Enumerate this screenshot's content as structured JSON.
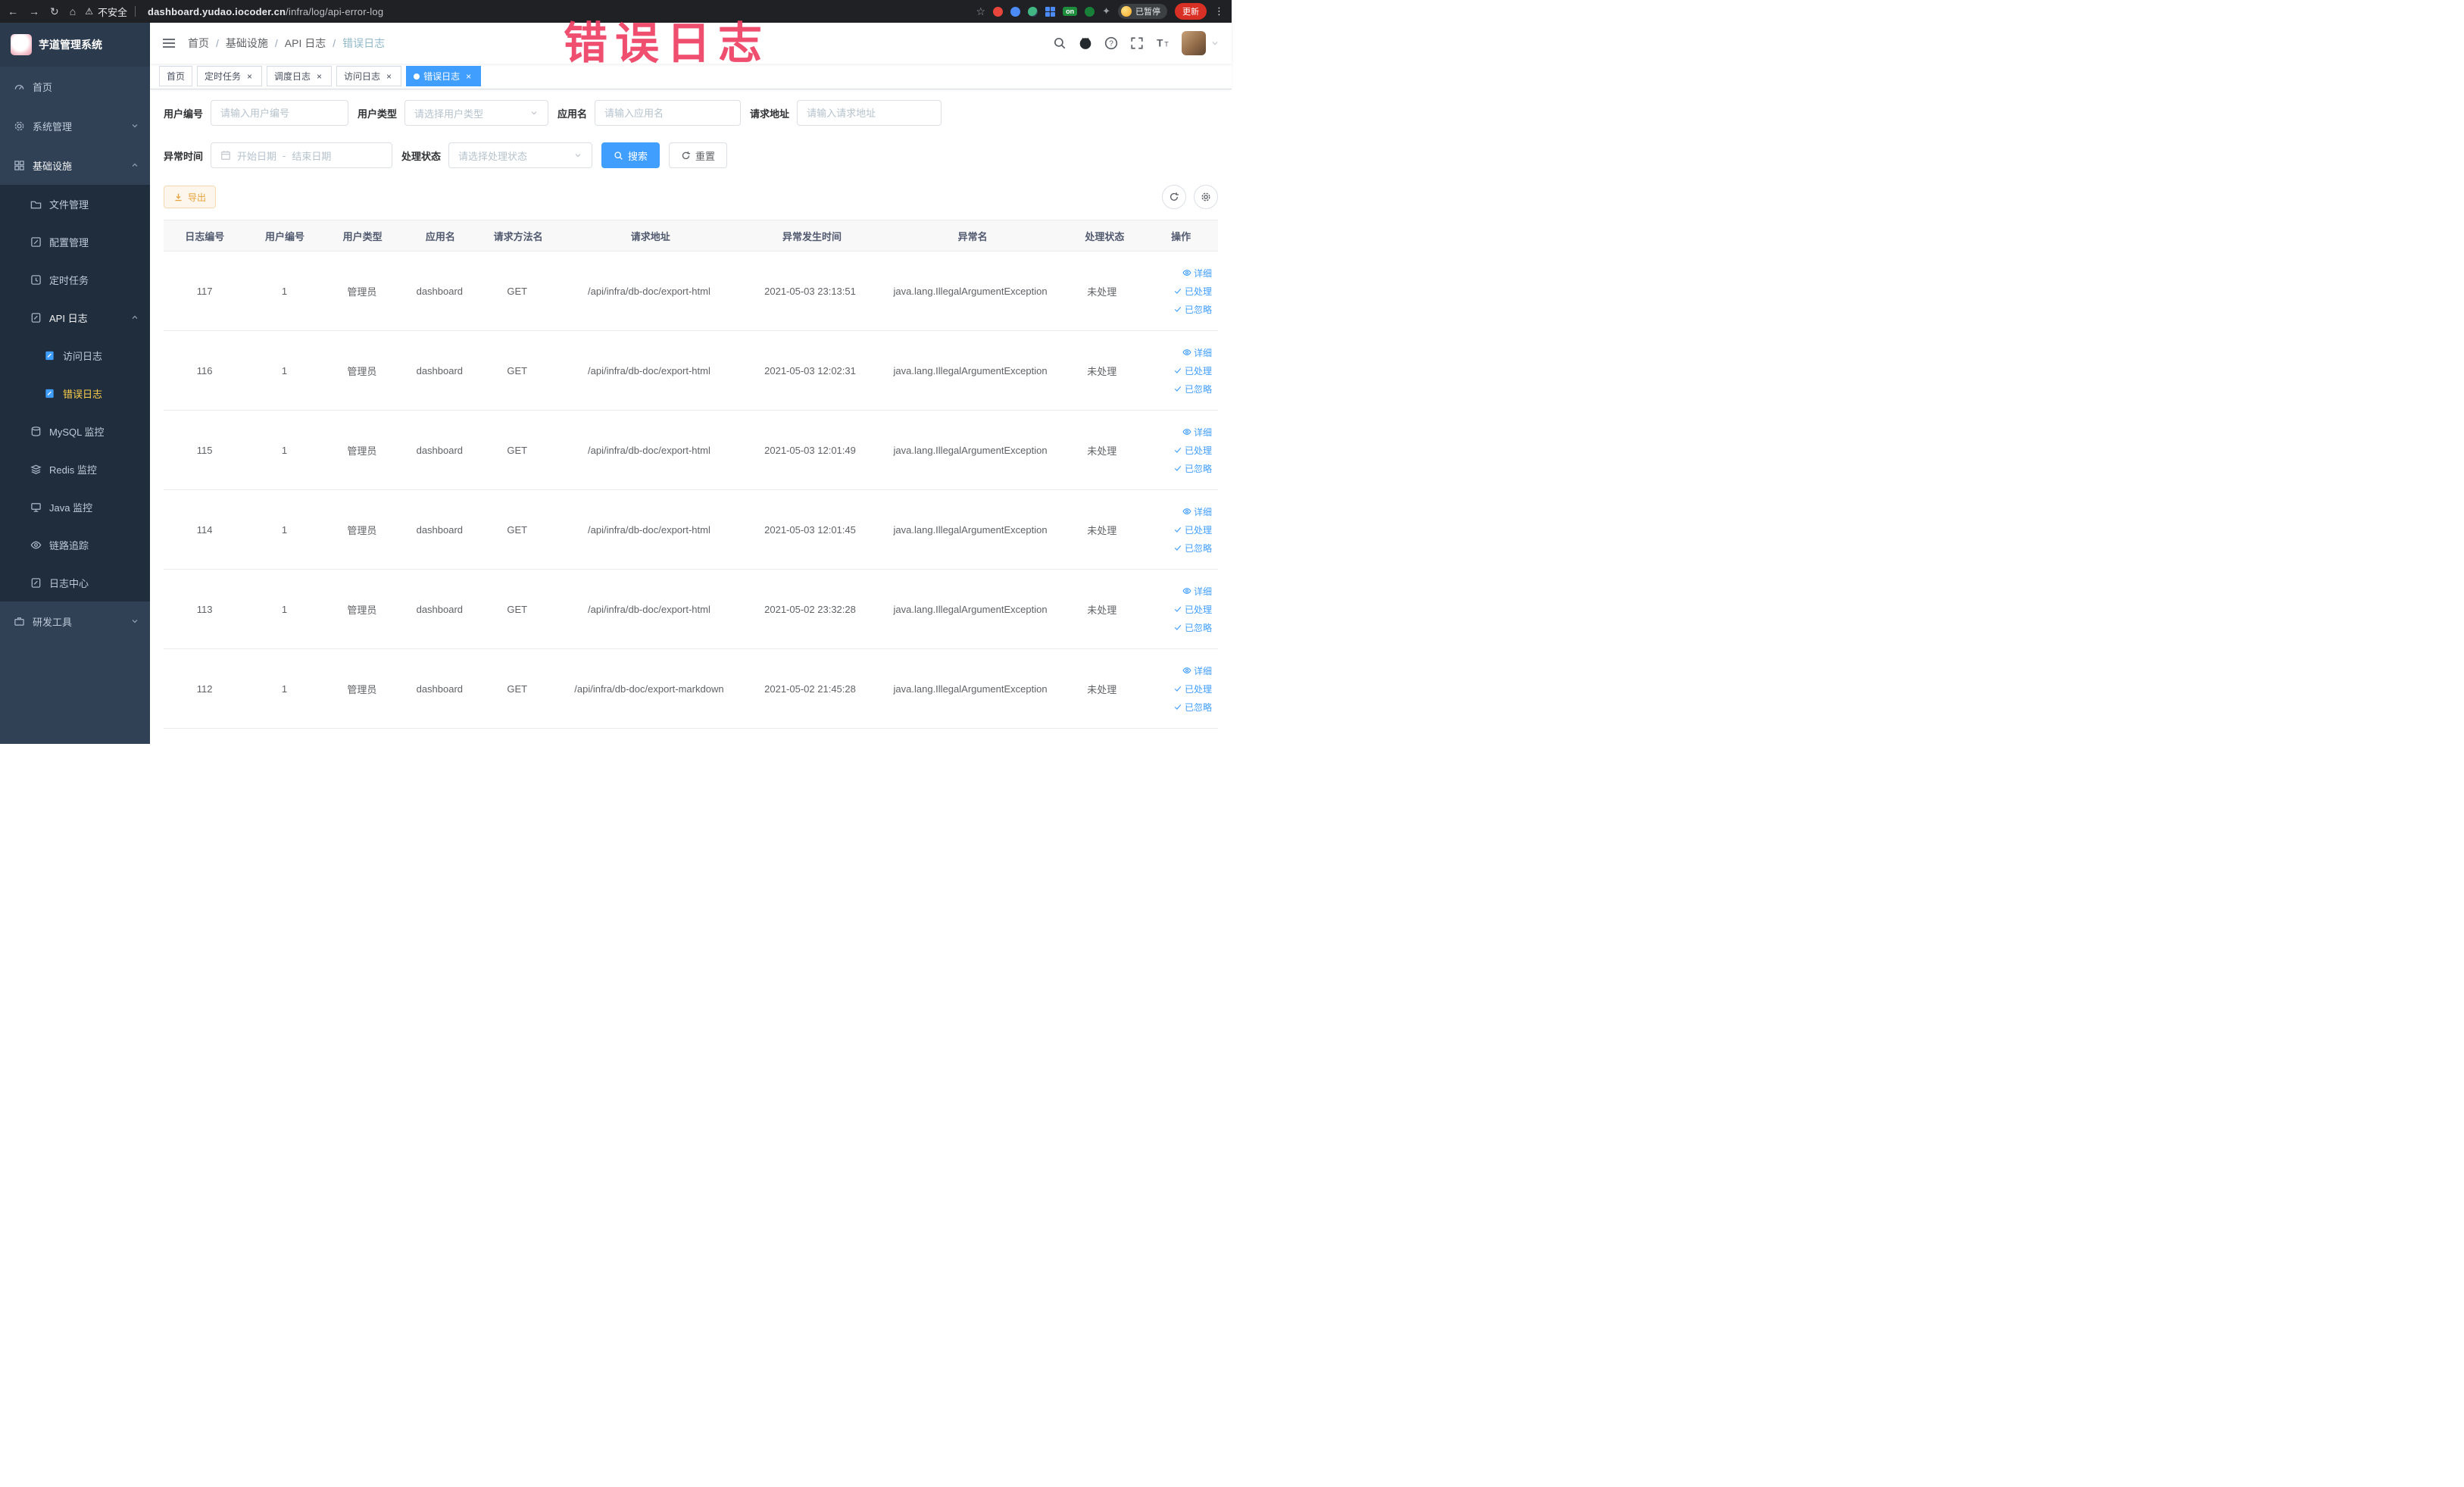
{
  "icons": {
    "close": "×",
    "caret_down": "▾"
  },
  "browser": {
    "back": "←",
    "forward": "→",
    "reload": "↻",
    "home": "⌂",
    "warning": "⚠",
    "security_label": "不安全",
    "url_host": "dashboard.yudao.iocoder.cn",
    "url_path": "/infra/log/api-error-log",
    "star": "☆",
    "on_badge": "on",
    "paused_label": "已暂停",
    "update_label": "更新",
    "kebab": "⋮"
  },
  "sidebar": {
    "title": "芋道管理系统",
    "items": {
      "home": "首页",
      "system": "系统管理",
      "infra": "基础设施",
      "file": "文件管理",
      "config": "配置管理",
      "job": "定时任务",
      "api_log": "API 日志",
      "access_log": "访问日志",
      "error_log": "错误日志",
      "mysql": "MySQL 监控",
      "redis": "Redis 监控",
      "java": "Java 监控",
      "trace": "链路追踪",
      "log_center": "日志中心",
      "dev": "研发工具"
    }
  },
  "header": {
    "breadcrumbs": [
      "首页",
      "基础设施",
      "API 日志",
      "错误日志"
    ],
    "separator": "/"
  },
  "tabs": [
    {
      "label": "首页",
      "closable": false,
      "active": false
    },
    {
      "label": "定时任务",
      "closable": true,
      "active": false
    },
    {
      "label": "调度日志",
      "closable": true,
      "active": false
    },
    {
      "label": "访问日志",
      "closable": true,
      "active": false
    },
    {
      "label": "错误日志",
      "closable": true,
      "active": true
    }
  ],
  "annotation": {
    "text": "错误日志"
  },
  "filters": {
    "user_id_label": "用户编号",
    "user_id_placeholder": "请输入用户编号",
    "user_type_label": "用户类型",
    "user_type_placeholder": "请选择用户类型",
    "app_name_label": "应用名",
    "app_name_placeholder": "请输入应用名",
    "request_url_label": "请求地址",
    "request_url_placeholder": "请输入请求地址",
    "exception_time_label": "异常时间",
    "start_date_placeholder": "开始日期",
    "range_separator": "-",
    "end_date_placeholder": "结束日期",
    "process_status_label": "处理状态",
    "process_status_placeholder": "请选择处理状态",
    "search_label": "搜索",
    "reset_label": "重置"
  },
  "toolbar": {
    "export_label": "导出"
  },
  "table": {
    "columns": [
      "日志编号",
      "用户编号",
      "用户类型",
      "应用名",
      "请求方法名",
      "请求地址",
      "异常发生时间",
      "异常名",
      "处理状态",
      "操作"
    ],
    "actions": {
      "detail": "详细",
      "processed": "已处理",
      "ignored": "已忽略"
    },
    "rows": [
      {
        "id": "117",
        "user_id": "1",
        "user_type": "管理员",
        "app": "dashboard",
        "method": "GET",
        "url": "/api/infra/db-doc/export-html",
        "time": "2021-05-03 23:13:51",
        "exception": "java.lang.IllegalArgumentException",
        "status": "未处理"
      },
      {
        "id": "116",
        "user_id": "1",
        "user_type": "管理员",
        "app": "dashboard",
        "method": "GET",
        "url": "/api/infra/db-doc/export-html",
        "time": "2021-05-03 12:02:31",
        "exception": "java.lang.IllegalArgumentException",
        "status": "未处理"
      },
      {
        "id": "115",
        "user_id": "1",
        "user_type": "管理员",
        "app": "dashboard",
        "method": "GET",
        "url": "/api/infra/db-doc/export-html",
        "time": "2021-05-03 12:01:49",
        "exception": "java.lang.IllegalArgumentException",
        "status": "未处理"
      },
      {
        "id": "114",
        "user_id": "1",
        "user_type": "管理员",
        "app": "dashboard",
        "method": "GET",
        "url": "/api/infra/db-doc/export-html",
        "time": "2021-05-03 12:01:45",
        "exception": "java.lang.IllegalArgumentException",
        "status": "未处理"
      },
      {
        "id": "113",
        "user_id": "1",
        "user_type": "管理员",
        "app": "dashboard",
        "method": "GET",
        "url": "/api/infra/db-doc/export-html",
        "time": "2021-05-02 23:32:28",
        "exception": "java.lang.IllegalArgumentException",
        "status": "未处理"
      },
      {
        "id": "112",
        "user_id": "1",
        "user_type": "管理员",
        "app": "dashboard",
        "method": "GET",
        "url": "/api/infra/db-doc/export-markdown",
        "time": "2021-05-02 21:45:28",
        "exception": "java.lang.IllegalArgumentException",
        "status": "未处理"
      }
    ]
  }
}
